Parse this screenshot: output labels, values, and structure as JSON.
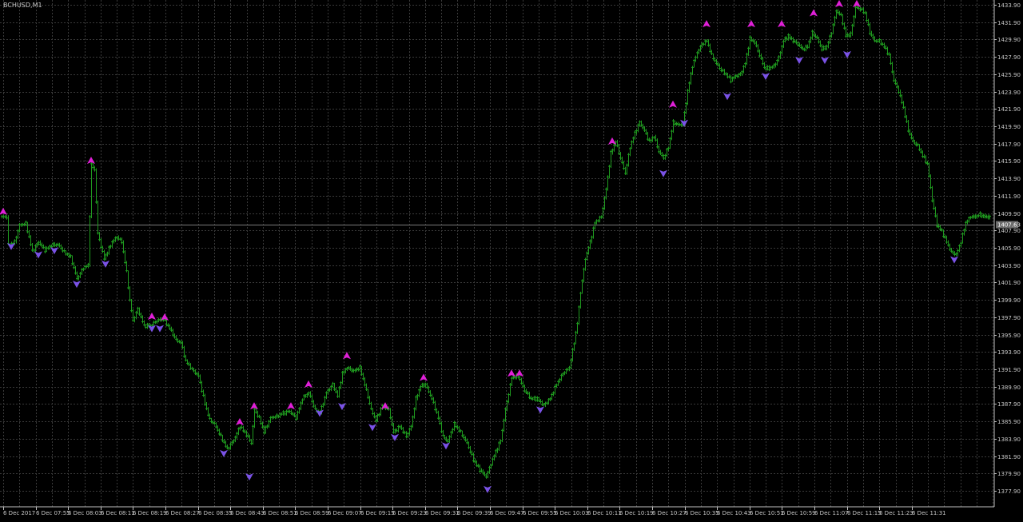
{
  "symbol_label": "BCHUSD,M1",
  "current_price_label": "1407.63",
  "colors": {
    "background": "#000000",
    "grid": "#3a3a3a",
    "bar": "#1f9a1f",
    "text": "#c8c8c8",
    "axis": "#c0c0c0",
    "up_arrow": "#e020d8",
    "down_arrow": "#7a52e6",
    "price_line": "#7a7a7a",
    "price_tag_bg": "#6c6c6c"
  },
  "chart_data": {
    "type": "line",
    "grid": true,
    "ylim": [
      1375.9,
      1433.9
    ],
    "y_ticks": [
      "1433.90",
      "1431.90",
      "1429.90",
      "1427.90",
      "1425.90",
      "1423.90",
      "1421.90",
      "1419.90",
      "1417.90",
      "1415.90",
      "1413.90",
      "1411.90",
      "1409.90",
      "1407.90",
      "1405.90",
      "1403.90",
      "1401.90",
      "1399.90",
      "1397.90",
      "1395.90",
      "1393.90",
      "1391.90",
      "1389.90",
      "1387.90",
      "1385.90",
      "1383.90",
      "1381.90",
      "1379.90",
      "1377.90"
    ],
    "x_ticks": [
      "6 Dec 2017",
      "6 Dec 07:55",
      "6 Dec 08:03",
      "6 Dec 08:11",
      "6 Dec 08:19",
      "6 Dec 08:27",
      "6 Dec 08:35",
      "6 Dec 08:43",
      "6 Dec 08:51",
      "6 Dec 08:59",
      "6 Dec 09:07",
      "6 Dec 09:15",
      "6 Dec 09:23",
      "6 Dec 09:31",
      "6 Dec 09:39",
      "6 Dec 09:47",
      "6 Dec 09:55",
      "6 Dec 10:03",
      "6 Dec 10:11",
      "6 Dec 10:19",
      "6 Dec 10:27",
      "6 Dec 10:35",
      "6 Dec 10:43",
      "6 Dec 10:51",
      "6 Dec 10:59",
      "6 Dec 11:07",
      "6 Dec 11:15",
      "6 Dec 11:23",
      "6 Dec 11:31"
    ],
    "current_price": 1407.63,
    "price_path": [
      [
        0,
        1408.6
      ],
      [
        8,
        1408.6
      ],
      [
        10,
        1405.2
      ],
      [
        18,
        1405.6
      ],
      [
        24,
        1407.6
      ],
      [
        32,
        1407.8
      ],
      [
        40,
        1404.5
      ],
      [
        48,
        1405.6
      ],
      [
        56,
        1404.6
      ],
      [
        64,
        1405.2
      ],
      [
        72,
        1405.3
      ],
      [
        80,
        1404.4
      ],
      [
        88,
        1403.8
      ],
      [
        96,
        1401.2
      ],
      [
        104,
        1402.5
      ],
      [
        110,
        1402.8
      ],
      [
        114,
        1414.8
      ],
      [
        118,
        1414.2
      ],
      [
        122,
        1406.6
      ],
      [
        130,
        1403.6
      ],
      [
        140,
        1405.6
      ],
      [
        146,
        1406.2
      ],
      [
        152,
        1405.6
      ],
      [
        158,
        1402.0
      ],
      [
        162,
        1398.6
      ],
      [
        166,
        1396.2
      ],
      [
        172,
        1397.6
      ],
      [
        180,
        1395.6
      ],
      [
        188,
        1395.6
      ],
      [
        196,
        1396.2
      ],
      [
        204,
        1396.4
      ],
      [
        212,
        1395.3
      ],
      [
        220,
        1393.9
      ],
      [
        226,
        1393.6
      ],
      [
        232,
        1391.4
      ],
      [
        240,
        1390.4
      ],
      [
        248,
        1389.6
      ],
      [
        256,
        1386.3
      ],
      [
        262,
        1384.4
      ],
      [
        268,
        1383.9
      ],
      [
        276,
        1382.4
      ],
      [
        284,
        1380.9
      ],
      [
        292,
        1381.9
      ],
      [
        300,
        1383.6
      ],
      [
        308,
        1382.6
      ],
      [
        314,
        1381.6
      ],
      [
        318,
        1385.6
      ],
      [
        324,
        1384.6
      ],
      [
        330,
        1382.9
      ],
      [
        338,
        1384.6
      ],
      [
        346,
        1384.8
      ],
      [
        354,
        1385.2
      ],
      [
        362,
        1385.4
      ],
      [
        370,
        1384.6
      ],
      [
        378,
        1386.9
      ],
      [
        386,
        1387.6
      ],
      [
        394,
        1385.6
      ],
      [
        400,
        1385.2
      ],
      [
        408,
        1387.6
      ],
      [
        416,
        1388.6
      ],
      [
        422,
        1387.2
      ],
      [
        428,
        1389.9
      ],
      [
        434,
        1390.6
      ],
      [
        442,
        1390.2
      ],
      [
        450,
        1390.6
      ],
      [
        458,
        1387.9
      ],
      [
        464,
        1385.6
      ],
      [
        470,
        1384.3
      ],
      [
        478,
        1386.1
      ],
      [
        486,
        1385.6
      ],
      [
        492,
        1382.9
      ],
      [
        500,
        1383.6
      ],
      [
        508,
        1382.4
      ],
      [
        514,
        1383.6
      ],
      [
        520,
        1386.9
      ],
      [
        526,
        1388.4
      ],
      [
        532,
        1388.6
      ],
      [
        540,
        1386.9
      ],
      [
        548,
        1384.6
      ],
      [
        554,
        1382.4
      ],
      [
        560,
        1381.8
      ],
      [
        568,
        1383.9
      ],
      [
        576,
        1382.9
      ],
      [
        584,
        1381.6
      ],
      [
        592,
        1379.6
      ],
      [
        600,
        1378.4
      ],
      [
        608,
        1377.6
      ],
      [
        614,
        1379.1
      ],
      [
        620,
        1380.6
      ],
      [
        626,
        1381.9
      ],
      [
        632,
        1385.6
      ],
      [
        640,
        1389.4
      ],
      [
        648,
        1389.6
      ],
      [
        656,
        1387.9
      ],
      [
        664,
        1386.9
      ],
      [
        672,
        1386.9
      ],
      [
        680,
        1386.1
      ],
      [
        688,
        1386.9
      ],
      [
        696,
        1388.6
      ],
      [
        704,
        1389.9
      ],
      [
        712,
        1390.6
      ],
      [
        718,
        1393.6
      ],
      [
        722,
        1395.9
      ],
      [
        726,
        1399.6
      ],
      [
        732,
        1403.6
      ],
      [
        738,
        1405.6
      ],
      [
        744,
        1407.9
      ],
      [
        752,
        1408.6
      ],
      [
        758,
        1411.9
      ],
      [
        764,
        1416.2
      ],
      [
        770,
        1417.6
      ],
      [
        776,
        1415.6
      ],
      [
        782,
        1413.8
      ],
      [
        788,
        1416.9
      ],
      [
        794,
        1418.6
      ],
      [
        800,
        1419.9
      ],
      [
        806,
        1418.9
      ],
      [
        812,
        1417.6
      ],
      [
        818,
        1418.2
      ],
      [
        824,
        1416.4
      ],
      [
        830,
        1415.6
      ],
      [
        836,
        1416.9
      ],
      [
        842,
        1419.9
      ],
      [
        848,
        1419.6
      ],
      [
        854,
        1419.6
      ],
      [
        860,
        1423.6
      ],
      [
        866,
        1426.6
      ],
      [
        872,
        1428.2
      ],
      [
        878,
        1429.2
      ],
      [
        884,
        1429.6
      ],
      [
        890,
        1427.9
      ],
      [
        896,
        1426.9
      ],
      [
        902,
        1426.1
      ],
      [
        908,
        1425.6
      ],
      [
        914,
        1424.9
      ],
      [
        920,
        1425.4
      ],
      [
        926,
        1425.6
      ],
      [
        932,
        1426.9
      ],
      [
        938,
        1429.9
      ],
      [
        944,
        1429.4
      ],
      [
        950,
        1427.9
      ],
      [
        956,
        1426.4
      ],
      [
        962,
        1426.3
      ],
      [
        968,
        1426.6
      ],
      [
        974,
        1427.6
      ],
      [
        980,
        1429.6
      ],
      [
        986,
        1430.2
      ],
      [
        992,
        1429.6
      ],
      [
        998,
        1429.2
      ],
      [
        1004,
        1428.6
      ],
      [
        1010,
        1428.9
      ],
      [
        1016,
        1430.6
      ],
      [
        1022,
        1429.9
      ],
      [
        1028,
        1428.6
      ],
      [
        1034,
        1428.9
      ],
      [
        1040,
        1430.6
      ],
      [
        1046,
        1433.2
      ],
      [
        1052,
        1432.6
      ],
      [
        1058,
        1430.2
      ],
      [
        1064,
        1430.4
      ],
      [
        1070,
        1433.6
      ],
      [
        1076,
        1433.4
      ],
      [
        1082,
        1432.9
      ],
      [
        1088,
        1430.6
      ],
      [
        1094,
        1429.6
      ],
      [
        1100,
        1429.6
      ],
      [
        1106,
        1428.9
      ],
      [
        1112,
        1427.9
      ],
      [
        1118,
        1424.9
      ],
      [
        1124,
        1423.6
      ],
      [
        1130,
        1421.6
      ],
      [
        1136,
        1418.9
      ],
      [
        1142,
        1417.6
      ],
      [
        1148,
        1417.1
      ],
      [
        1154,
        1415.9
      ],
      [
        1160,
        1414.9
      ],
      [
        1166,
        1410.6
      ],
      [
        1172,
        1407.6
      ],
      [
        1178,
        1406.9
      ],
      [
        1184,
        1405.6
      ],
      [
        1190,
        1404.4
      ],
      [
        1196,
        1404.1
      ],
      [
        1202,
        1405.6
      ],
      [
        1208,
        1407.9
      ],
      [
        1214,
        1408.6
      ],
      [
        1220,
        1408.6
      ],
      [
        1226,
        1408.9
      ],
      [
        1232,
        1408.6
      ],
      [
        1238,
        1408.6
      ]
    ],
    "up_arrows": [
      [
        4,
        1409.2
      ],
      [
        114,
        1415.3
      ],
      [
        190,
        1396.7
      ],
      [
        206,
        1396.6
      ],
      [
        300,
        1384.1
      ],
      [
        318,
        1386.0
      ],
      [
        364,
        1386.0
      ],
      [
        386,
        1388.6
      ],
      [
        434,
        1392.0
      ],
      [
        482,
        1386.0
      ],
      [
        530,
        1389.4
      ],
      [
        640,
        1389.9
      ],
      [
        650,
        1389.9
      ],
      [
        766,
        1417.6
      ],
      [
        842,
        1422.0
      ],
      [
        884,
        1431.6
      ],
      [
        940,
        1431.6
      ],
      [
        978,
        1431.6
      ],
      [
        1018,
        1432.9
      ],
      [
        1050,
        1434.0
      ],
      [
        1072,
        1434.0
      ]
    ],
    "down_arrows": [
      [
        14,
        1405.1
      ],
      [
        48,
        1404.1
      ],
      [
        68,
        1404.6
      ],
      [
        96,
        1400.6
      ],
      [
        132,
        1403.0
      ],
      [
        190,
        1395.3
      ],
      [
        200,
        1395.3
      ],
      [
        280,
        1380.4
      ],
      [
        312,
        1377.6
      ],
      [
        400,
        1385.2
      ],
      [
        428,
        1386.0
      ],
      [
        466,
        1383.5
      ],
      [
        494,
        1382.3
      ],
      [
        558,
        1381.3
      ],
      [
        610,
        1376.1
      ],
      [
        676,
        1385.6
      ],
      [
        830,
        1413.8
      ],
      [
        856,
        1419.8
      ],
      [
        910,
        1423.0
      ],
      [
        958,
        1425.4
      ],
      [
        1000,
        1427.3
      ],
      [
        1032,
        1427.3
      ],
      [
        1060,
        1428.0
      ],
      [
        1194,
        1403.5
      ]
    ]
  }
}
